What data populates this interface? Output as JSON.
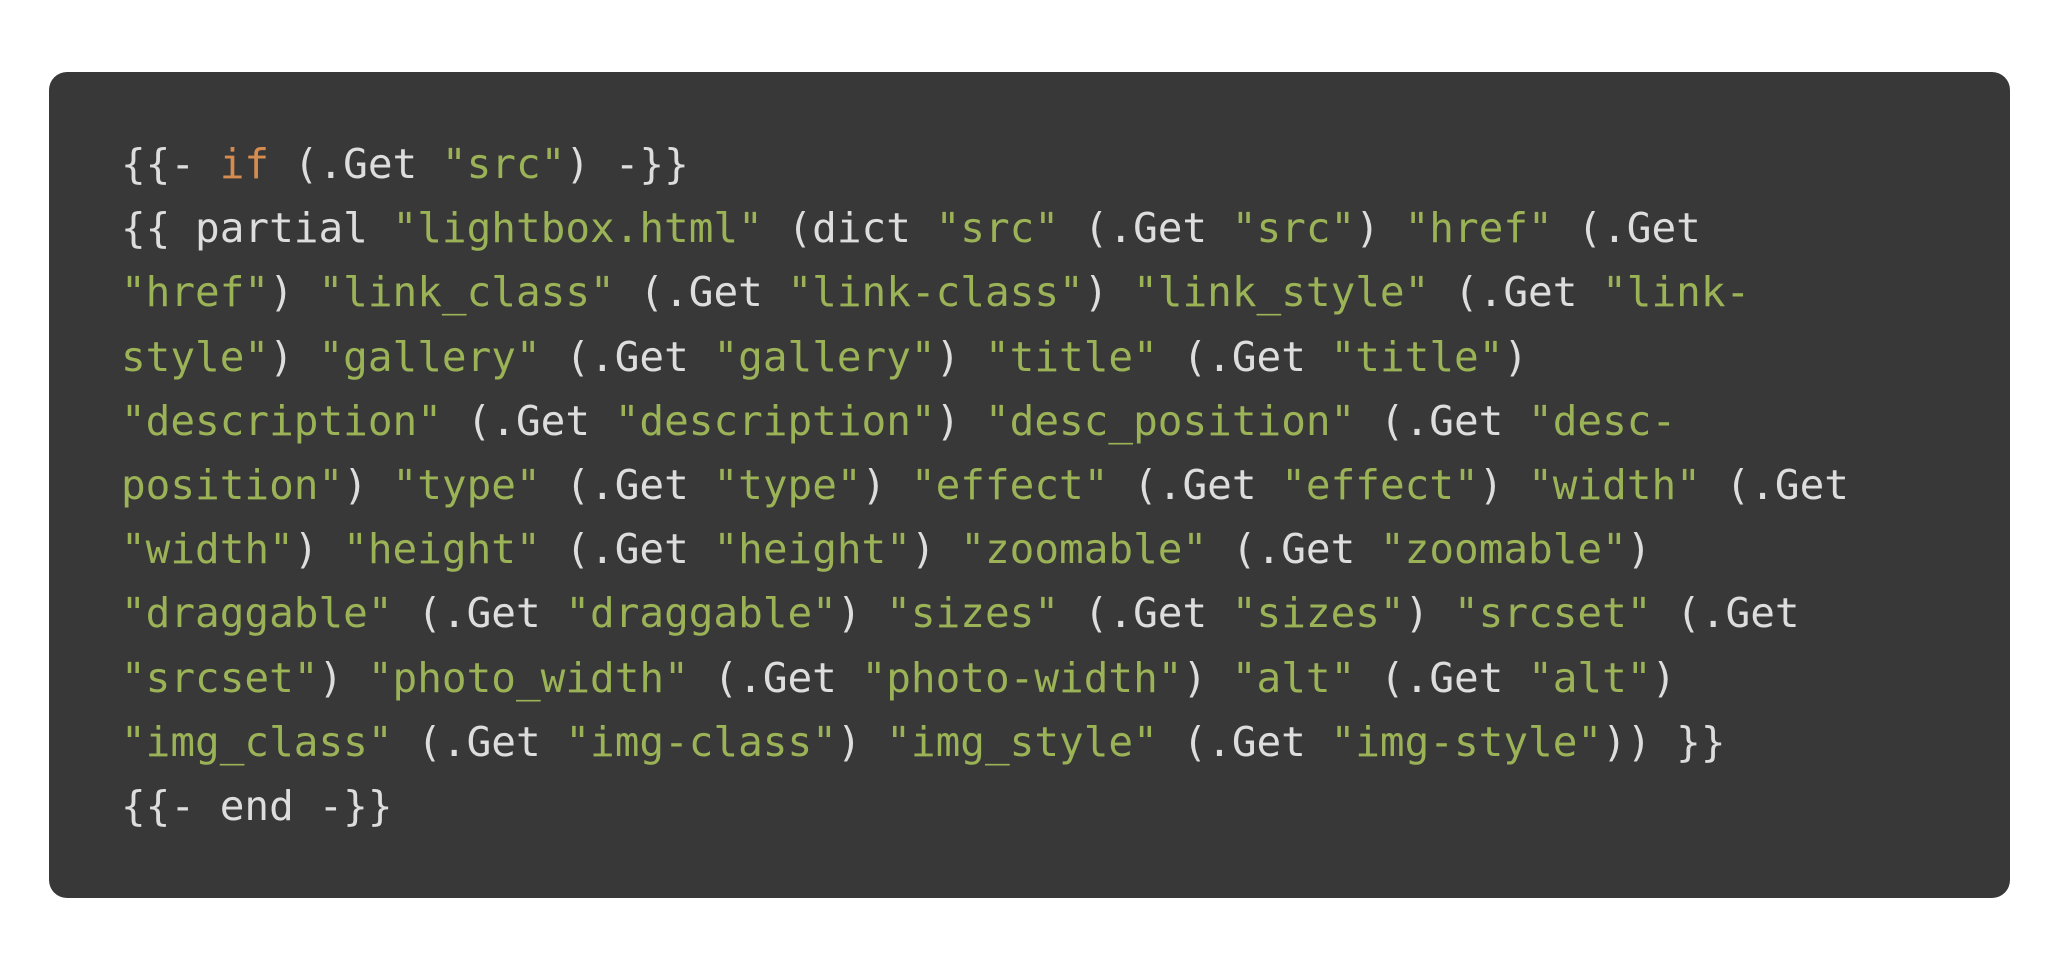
{
  "colors": {
    "background": "#ffffff",
    "code_background": "#383838",
    "text": "#dddddd",
    "keyword": "#d58c50",
    "string": "#9bb356"
  },
  "code": {
    "lines": [
      [
        [
          "p",
          "{{- "
        ],
        [
          "k",
          "if"
        ],
        [
          "p",
          " (.Get "
        ],
        [
          "s",
          "\"src\""
        ],
        [
          "p",
          ") -}}"
        ]
      ],
      [
        [
          "p",
          "{{ partial "
        ],
        [
          "s",
          "\"lightbox.html\""
        ],
        [
          "p",
          " (dict "
        ],
        [
          "s",
          "\"src\""
        ],
        [
          "p",
          " (.Get "
        ],
        [
          "s",
          "\"src\""
        ],
        [
          "p",
          ") "
        ],
        [
          "s",
          "\"href\""
        ],
        [
          "p",
          " (.Get"
        ]
      ],
      [
        [
          "s",
          "\"href\""
        ],
        [
          "p",
          ") "
        ],
        [
          "s",
          "\"link_class\""
        ],
        [
          "p",
          " (.Get "
        ],
        [
          "s",
          "\"link-class\""
        ],
        [
          "p",
          ") "
        ],
        [
          "s",
          "\"link_style\""
        ],
        [
          "p",
          " (.Get "
        ],
        [
          "s",
          "\"link-"
        ]
      ],
      [
        [
          "s",
          "style\""
        ],
        [
          "p",
          ") "
        ],
        [
          "s",
          "\"gallery\""
        ],
        [
          "p",
          " (.Get "
        ],
        [
          "s",
          "\"gallery\""
        ],
        [
          "p",
          ") "
        ],
        [
          "s",
          "\"title\""
        ],
        [
          "p",
          " (.Get "
        ],
        [
          "s",
          "\"title\""
        ],
        [
          "p",
          ")"
        ]
      ],
      [
        [
          "s",
          "\"description\""
        ],
        [
          "p",
          " (.Get "
        ],
        [
          "s",
          "\"description\""
        ],
        [
          "p",
          ") "
        ],
        [
          "s",
          "\"desc_position\""
        ],
        [
          "p",
          " (.Get "
        ],
        [
          "s",
          "\"desc-"
        ]
      ],
      [
        [
          "s",
          "position\""
        ],
        [
          "p",
          ") "
        ],
        [
          "s",
          "\"type\""
        ],
        [
          "p",
          " (.Get "
        ],
        [
          "s",
          "\"type\""
        ],
        [
          "p",
          ") "
        ],
        [
          "s",
          "\"effect\""
        ],
        [
          "p",
          " (.Get "
        ],
        [
          "s",
          "\"effect\""
        ],
        [
          "p",
          ") "
        ],
        [
          "s",
          "\"width\""
        ],
        [
          "p",
          " (.Get"
        ]
      ],
      [
        [
          "s",
          "\"width\""
        ],
        [
          "p",
          ") "
        ],
        [
          "s",
          "\"height\""
        ],
        [
          "p",
          " (.Get "
        ],
        [
          "s",
          "\"height\""
        ],
        [
          "p",
          ") "
        ],
        [
          "s",
          "\"zoomable\""
        ],
        [
          "p",
          " (.Get "
        ],
        [
          "s",
          "\"zoomable\""
        ],
        [
          "p",
          ")"
        ]
      ],
      [
        [
          "s",
          "\"draggable\""
        ],
        [
          "p",
          " (.Get "
        ],
        [
          "s",
          "\"draggable\""
        ],
        [
          "p",
          ") "
        ],
        [
          "s",
          "\"sizes\""
        ],
        [
          "p",
          " (.Get "
        ],
        [
          "s",
          "\"sizes\""
        ],
        [
          "p",
          ") "
        ],
        [
          "s",
          "\"srcset\""
        ],
        [
          "p",
          " (.Get"
        ]
      ],
      [
        [
          "s",
          "\"srcset\""
        ],
        [
          "p",
          ") "
        ],
        [
          "s",
          "\"photo_width\""
        ],
        [
          "p",
          " (.Get "
        ],
        [
          "s",
          "\"photo-width\""
        ],
        [
          "p",
          ") "
        ],
        [
          "s",
          "\"alt\""
        ],
        [
          "p",
          " (.Get "
        ],
        [
          "s",
          "\"alt\""
        ],
        [
          "p",
          ")"
        ]
      ],
      [
        [
          "s",
          "\"img_class\""
        ],
        [
          "p",
          " (.Get "
        ],
        [
          "s",
          "\"img-class\""
        ],
        [
          "p",
          ") "
        ],
        [
          "s",
          "\"img_style\""
        ],
        [
          "p",
          " (.Get "
        ],
        [
          "s",
          "\"img-style\""
        ],
        [
          "p",
          ")) }}"
        ]
      ],
      [
        [
          "p",
          "{{- end -}}"
        ]
      ]
    ]
  }
}
